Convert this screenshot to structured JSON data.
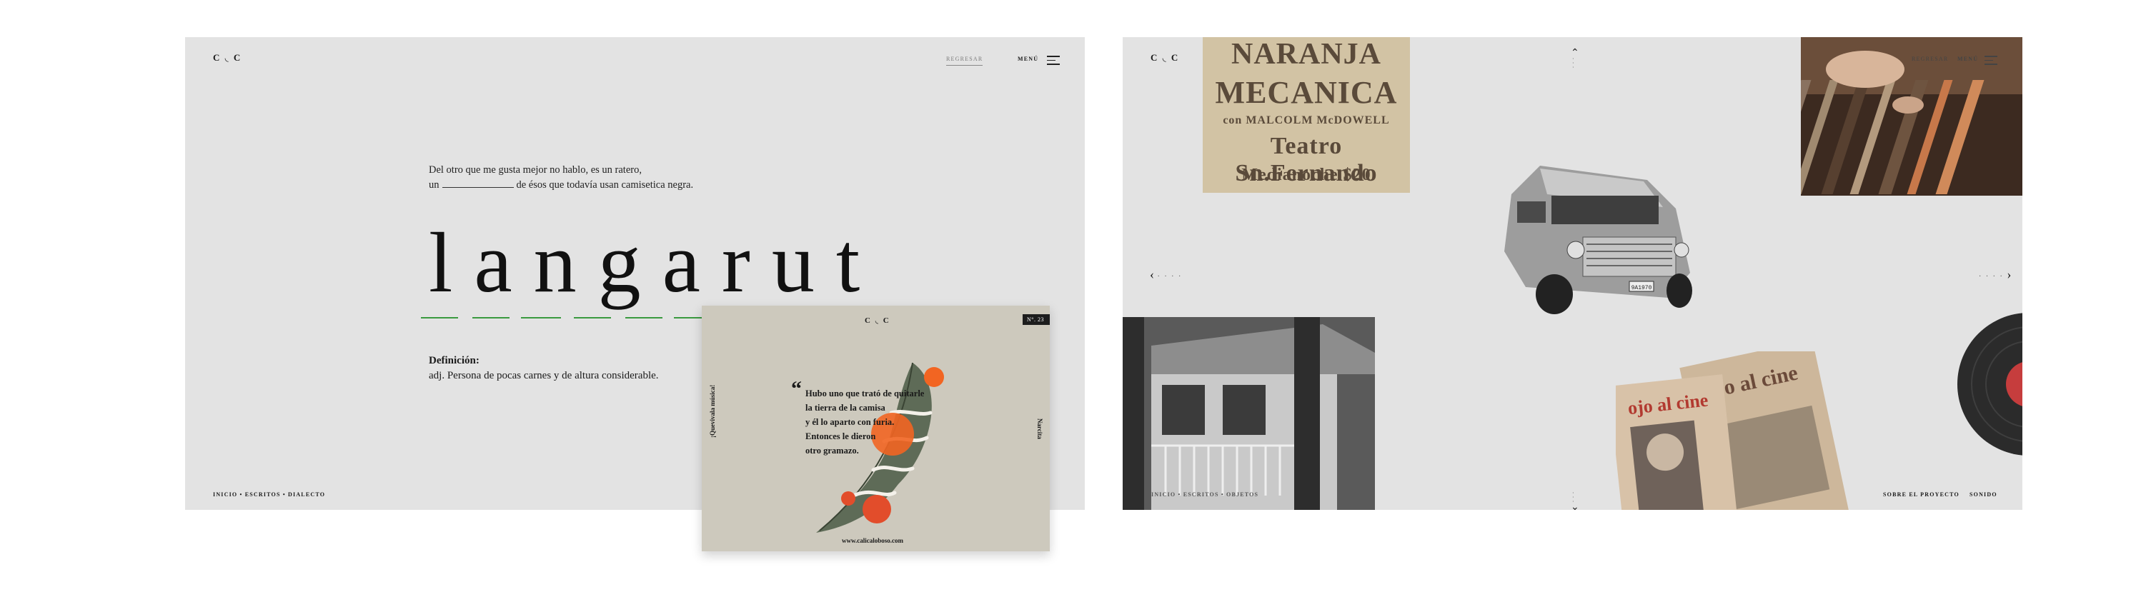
{
  "brand": {
    "logo": "C ◟ C"
  },
  "left_screen": {
    "nav": {
      "back_label": "REGRESAR",
      "menu_label": "MENÚ"
    },
    "quote": {
      "line1": "Del otro que me gusta mejor no hablo, es un ratero,",
      "line2_prefix": "un",
      "line2_suffix": "de ésos que todavía usan camisetica negra."
    },
    "word": "langarut",
    "definition": {
      "title": "Definición:",
      "text": "adj. Persona de pocas carnes y de altura considerable."
    },
    "breadcrumb": "INICIO  •  ESCRITOS  •  DIALECTO",
    "underline_color": "#3a9a3f"
  },
  "card": {
    "issue": "N°. 23",
    "left_vertical": "¡Quevivala música!",
    "right_vertical": "Narcita",
    "quote_lines": [
      "Hubo uno que trató de quitarle",
      "la tierra de la camisa",
      "y él lo aparto con furia.",
      "Entonces le dieron",
      "otro gramazo."
    ],
    "url": "www.calicaloboso.com",
    "accent": "#f26522"
  },
  "right_screen": {
    "nav": {
      "back_label": "REGRESAR",
      "menu_label": "MENÚ"
    },
    "poster_lines": [
      "NARANJA",
      "MECANICA",
      "con MALCOLM McDOWELL",
      "Teatro Sn.Fernando",
      "Medianoche   $20"
    ],
    "bus_plate": "9A1970",
    "magazines": [
      "ojo al cine",
      "ojo al cine"
    ],
    "breadcrumb": "INICIO  •  ESCRITOS  •  OBJETOS",
    "about_label": "SOBRE EL PROYECTO",
    "sound_label": "SONIDO",
    "arrows": {
      "up": "⌃",
      "down": "⌄",
      "left": "‹",
      "right": "›"
    }
  }
}
